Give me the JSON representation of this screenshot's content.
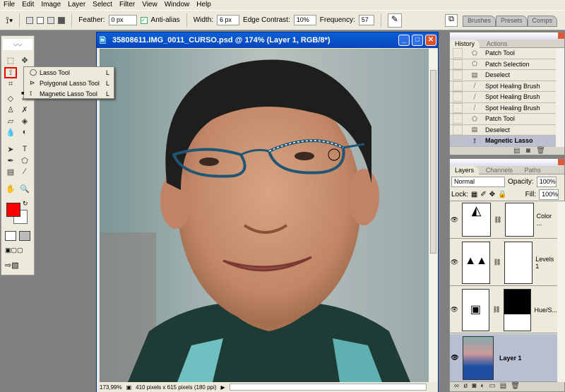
{
  "menu": [
    "File",
    "Edit",
    "Image",
    "Layer",
    "Select",
    "Filter",
    "View",
    "Window",
    "Help"
  ],
  "options": {
    "feather_label": "Feather:",
    "feather": "0 px",
    "antialias": "Anti-alias",
    "width_label": "Width:",
    "width": "6 px",
    "edge_label": "Edge Contrast:",
    "edge": "10%",
    "freq_label": "Frequency:",
    "freq": "57"
  },
  "wells": [
    "Brushes",
    "Presets",
    "Comps"
  ],
  "flyout": [
    {
      "label": "Lasso Tool",
      "key": "L"
    },
    {
      "label": "Polygonal Lasso Tool",
      "key": "L"
    },
    {
      "label": "Magnetic Lasso Tool",
      "key": "L"
    }
  ],
  "doc": {
    "title": "35808611.IMG_0011_CURSO.psd @ 174% (Layer 1, RGB/8*)",
    "zoom": "173,99%",
    "info": "410 pixels x 615 pixels (180 ppi)"
  },
  "history": {
    "tabs": [
      "History",
      "Actions"
    ],
    "items": [
      "Patch Tool",
      "Patch Selection",
      "Deselect",
      "Spot Healing Brush",
      "Spot Healing Brush",
      "Spot Healing Brush",
      "Patch Tool",
      "Deselect",
      "Magnetic Lasso"
    ]
  },
  "layers": {
    "tabs": [
      "Layers",
      "Channels",
      "Paths"
    ],
    "blend": "Normal",
    "opacity_label": "Opacity:",
    "opacity": "100%",
    "lock_label": "Lock:",
    "fill_label": "Fill:",
    "fill": "100%",
    "items": [
      "Color ...",
      "Levels 1",
      "Hue/S...",
      "Layer 1"
    ]
  },
  "colors": {
    "foreground": "#ff0000",
    "background": "#ffffff"
  }
}
